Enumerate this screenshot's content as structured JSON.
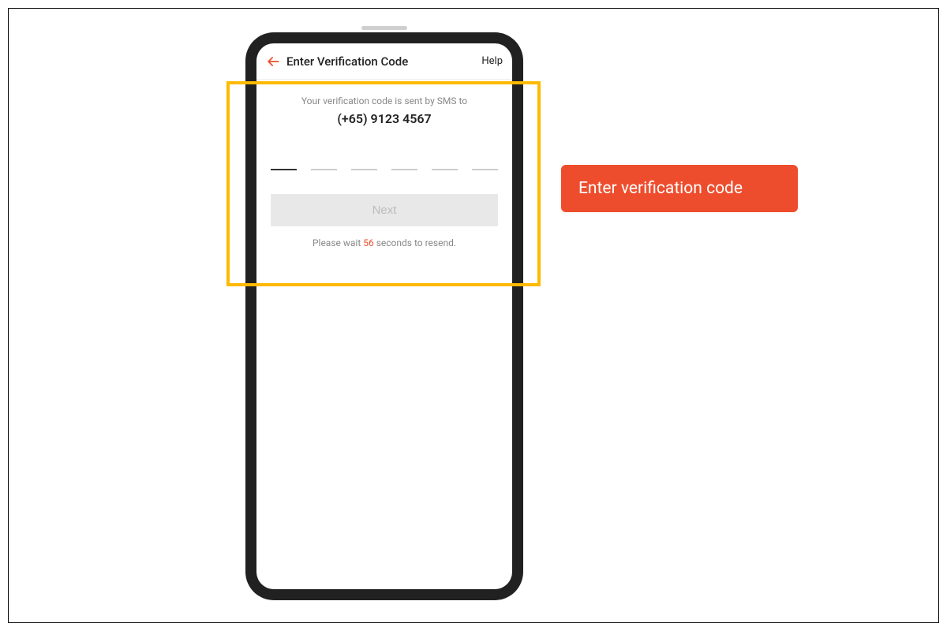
{
  "header": {
    "title": "Enter Verification Code",
    "help_label": "Help"
  },
  "verify": {
    "sent_to_text": "Your verification code is sent by SMS to",
    "phone_number": "(+65) 9123 4567",
    "next_label": "Next",
    "resend_prefix": "Please wait ",
    "resend_seconds": "56",
    "resend_suffix": " seconds to resend."
  },
  "callout": {
    "label": "Enter verification code"
  },
  "colors": {
    "accent": "#ee4d2d",
    "highlight": "#ffb900"
  }
}
